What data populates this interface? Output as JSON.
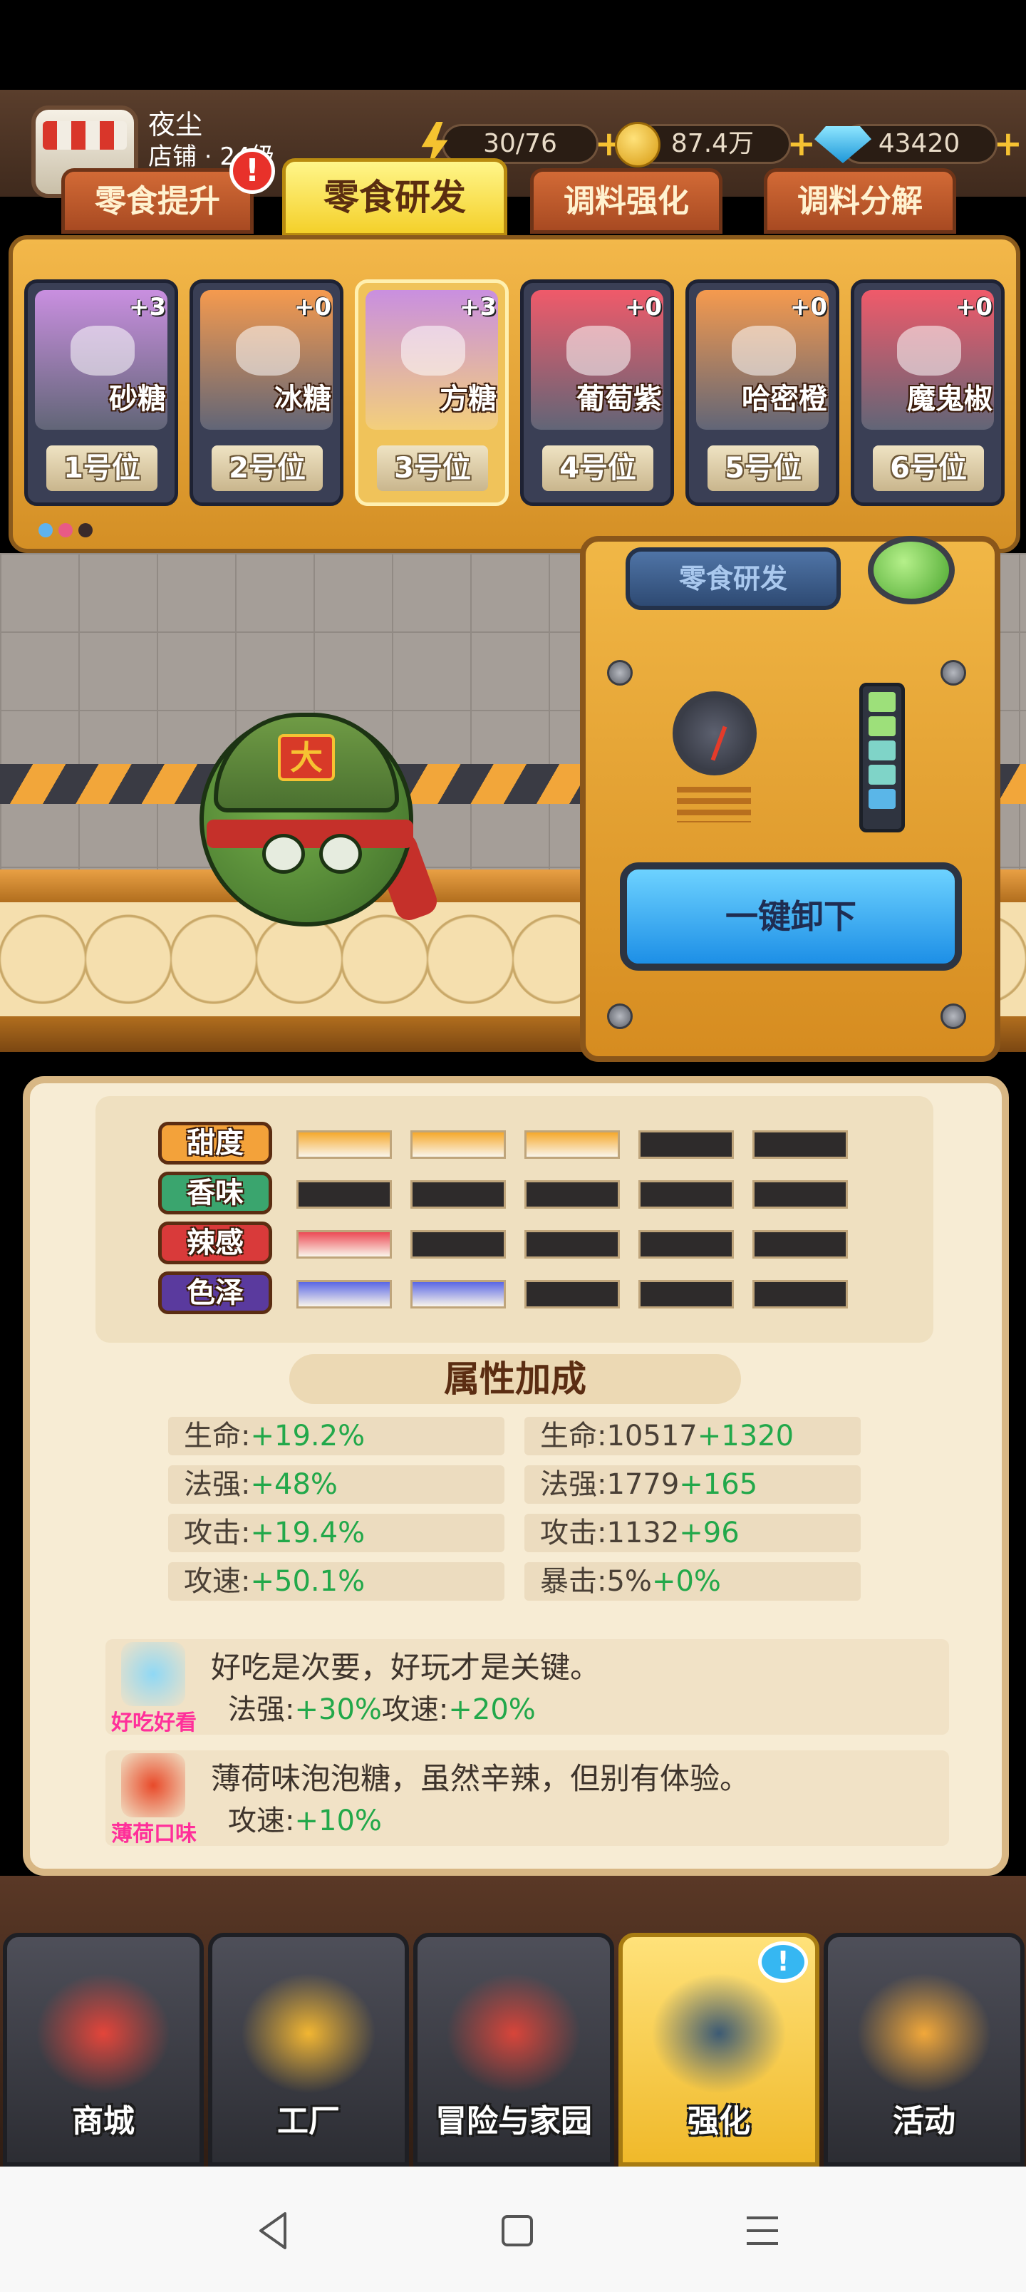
{
  "player": {
    "name": "夜尘",
    "shop_level": "店铺 · 24级"
  },
  "resources": {
    "energy": "30/76",
    "coins": "87.4万",
    "gems": "43420"
  },
  "tabs": [
    "零食提升",
    "零食研发",
    "调料强化",
    "调料分解"
  ],
  "tab_alert": "!",
  "slots": [
    {
      "name": "砂糖",
      "plus": "+3",
      "position": "1号位",
      "color": "#c98fe0"
    },
    {
      "name": "冰糖",
      "plus": "+0",
      "position": "2号位",
      "color": "#f59a4e"
    },
    {
      "name": "方糖",
      "plus": "+3",
      "position": "3号位",
      "color": "#c98fe0"
    },
    {
      "name": "葡萄紫",
      "plus": "+0",
      "position": "4号位",
      "color": "#f05a6a"
    },
    {
      "name": "哈密橙",
      "plus": "+0",
      "position": "5号位",
      "color": "#f59a4e"
    },
    {
      "name": "魔鬼椒",
      "plus": "+0",
      "position": "6号位",
      "color": "#f05a6a"
    }
  ],
  "character_badge": "大",
  "machine": {
    "sign": "零食研发",
    "unload_button": "一键卸下"
  },
  "attributes": [
    {
      "label": "甜度",
      "filled": 3,
      "of": 5,
      "color": "#f6a92c",
      "label_bg": "#f3a23a"
    },
    {
      "label": "香味",
      "filled": 0,
      "of": 5,
      "color": "#3bbf78",
      "label_bg": "#3aa56e"
    },
    {
      "label": "辣感",
      "filled": 1,
      "of": 5,
      "color": "#ec4a55",
      "label_bg": "#d93a3a"
    },
    {
      "label": "色泽",
      "filled": 2,
      "of": 5,
      "color": "#5a67e6",
      "label_bg": "#5a3a9e"
    }
  ],
  "bonus_title": "属性加成",
  "bonuses": {
    "left": [
      {
        "label": "生命:",
        "value": "+19.2%"
      },
      {
        "label": "法强:",
        "value": "+48%"
      },
      {
        "label": "攻击:",
        "value": "+19.4%"
      },
      {
        "label": "攻速:",
        "value": "+50.1%"
      }
    ],
    "right": [
      {
        "label": "生命:10517",
        "value": "+1320"
      },
      {
        "label": "法强:1779",
        "value": "+165"
      },
      {
        "label": "攻击:1132",
        "value": "+96"
      },
      {
        "label": "暴击:5%",
        "value": "+0%"
      }
    ]
  },
  "combos": [
    {
      "tag": "好吃好看",
      "text": "好吃是次要，好玩才是关键。",
      "b1_label": "法强:",
      "b1_value": "+30%",
      "b2_label": "攻速:",
      "b2_value": "+20%"
    },
    {
      "tag": "薄荷口味",
      "text": "薄荷味泡泡糖，虽然辛辣，但别有体验。",
      "b1_label": "攻速:",
      "b1_value": "+10%",
      "b2_label": "",
      "b2_value": ""
    }
  ],
  "nav": [
    "商城",
    "工厂",
    "冒险与家园",
    "强化",
    "活动"
  ],
  "nav_active": 3,
  "nav_badge": "!"
}
